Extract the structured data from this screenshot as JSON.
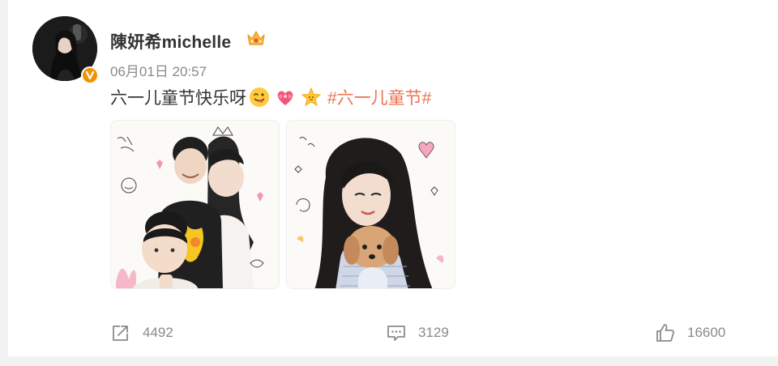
{
  "post": {
    "author": {
      "name": "陳妍希michelle",
      "avatar_icon": "avatar-portrait",
      "verified_icon": "verified-badge-icon",
      "badge_icon": "crown-icon"
    },
    "time": "06月01日 20:57",
    "text": "六一儿童节快乐呀",
    "emojis": [
      "tongue-wink-emoji",
      "heart-ribbon-emoji",
      "star-face-emoji"
    ],
    "hashtag": "#六一儿童节#",
    "images": [
      {
        "alt": "illustration-children",
        "icon": "children-illustration"
      },
      {
        "alt": "illustration-woman-dog",
        "icon": "woman-with-dog-illustration"
      }
    ]
  },
  "actions": {
    "repost_count": "4492",
    "comment_count": "3129",
    "like_count": "16600"
  },
  "colors": {
    "hashtag": "#eb7350",
    "verified": "#f29100",
    "meta_text": "#8a8a8a"
  }
}
